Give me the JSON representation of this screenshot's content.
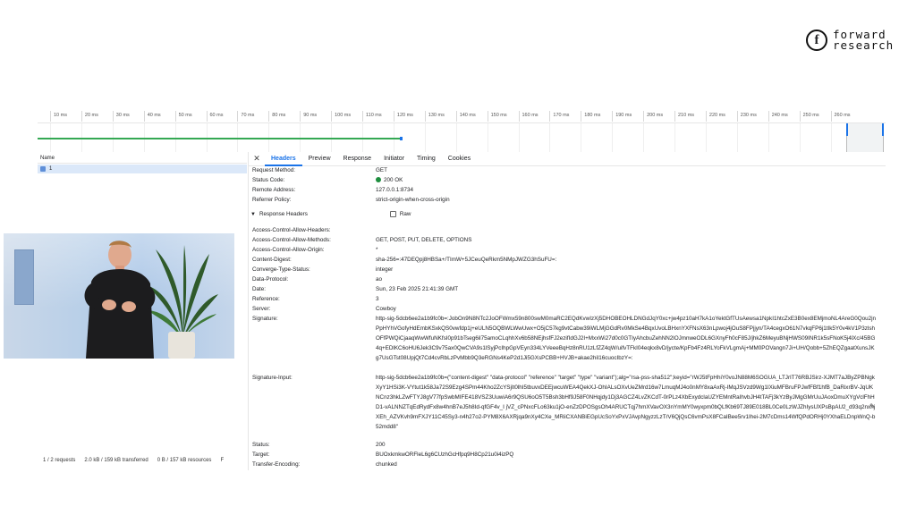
{
  "logo": {
    "mark": "f",
    "line1": "forward",
    "line2": "research"
  },
  "timeline": {
    "ticks": [
      "10 ms",
      "20 ms",
      "30 ms",
      "40 ms",
      "50 ms",
      "60 ms",
      "70 ms",
      "80 ms",
      "90 ms",
      "100 ms",
      "110 ms",
      "120 ms",
      "130 ms",
      "140 ms",
      "150 ms",
      "160 ms",
      "170 ms",
      "180 ms",
      "190 ms",
      "200 ms",
      "210 ms",
      "220 ms",
      "230 ms",
      "240 ms",
      "250 ms",
      "260 ms"
    ],
    "colors": {
      "waiting": "#34a853",
      "download": "#1a73e8"
    }
  },
  "requests": {
    "column_header": "Name",
    "rows": [
      {
        "name": "1"
      }
    ],
    "footer": {
      "count": "1 / 2 requests",
      "transferred": "2.0 kB / 159 kB transferred",
      "resources": "0 B / 157 kB resources",
      "extra": "F"
    }
  },
  "details": {
    "tabs": [
      "Headers",
      "Preview",
      "Response",
      "Initiator",
      "Timing",
      "Cookies"
    ],
    "active_tab": "Headers",
    "general": [
      {
        "k": "Request Method:",
        "v": "GET"
      },
      {
        "k": "Status Code:",
        "v": "200 OK"
      },
      {
        "k": "Remote Address:",
        "v": "127.0.0.1:8734"
      },
      {
        "k": "Referrer Policy:",
        "v": "strict-origin-when-cross-origin"
      }
    ],
    "response_headers_label": "Response Headers",
    "raw_label": "Raw",
    "headers": [
      {
        "k": "Access-Control-Allow-Headers:",
        "v": ""
      },
      {
        "k": "Access-Control-Allow-Methods:",
        "v": "GET, POST, PUT, DELETE, OPTIONS"
      },
      {
        "k": "Access-Control-Allow-Origin:",
        "v": "*"
      },
      {
        "k": "Content-Digest:",
        "v": "sha-256=:47DEQpj8HBSa+/TImW+5JCeuQeRkm5NMpJWZG3hSuFU=:"
      },
      {
        "k": "Converge-Type-Status:",
        "v": "integer"
      },
      {
        "k": "Data-Protocol:",
        "v": "ao"
      },
      {
        "k": "Date:",
        "v": "Sun, 23 Feb 2025 21:41:39 GMT"
      },
      {
        "k": "Reference:",
        "v": "3"
      },
      {
        "k": "Server:",
        "v": "Cowboy"
      }
    ],
    "signature_key": "Signature:",
    "signature_value": "http-sig-5dcb6ee2a1b9fc0b=:JobOn9N8NTc2JoOFWmx59n800swM0maRC2EQdKvwIzXj5DHOBEOHLDNGdJqY0xc+jw4pz10aH7kA1oYektGfTUsAewsa1NpkI1htcZxE3B0ex8EMjmoNL4AreG0Qou2jnPpHYhVGofyHdEmbKSxkQS0vwfdp1j+eULN5OQBWLWwUwx+O5jC57kg9vtCabw39iWLMjGGdRv0MkSe4BqxUvoLBHxnYXFNsX63nLpwoj4jOuS8FPjjyn/TA4cegxO61N7vkqFP6j1tIk5Y0v4kV1P3zlshOFfPWQiCjaaqWwWfuNKfsI0p91bTseg6il75amoCLqhhXv6b58NEjhsfFJ2ezifIdGJ2I+MxxWi27d0c0GTIyAhcbuZehNN2lOJmnweODL6GXnyFh0cF85J/jhkZ6MeyuBNjHWS09INR1k5sFNoK5j4lXc/45BG4q+EDlKC6oHU6Jek3C9v75ax0QwCVA9s1lSyjPcIhpGpVEyn334LYVeeeBqHz8nRU1zLfZZ4qW/uifvTFkI04eqkx8vD/jycte/KpFb4Fz4RLYoFkVLgmAj+MM0POVangn7Ji+UH/Qobb+5ZhEQZgaatXunsJKg7UsGTst08UpjQt7Cd4cvRbLzPvMbb9Q3eRGNs4KeP2d1Ji5GXsPCBB+HVJB+akae2hil16cuocIbzY=:",
    "signature_input_key": "Signature-Input:",
    "signature_input_value": "http-sig-5dcb6ee2a1b9fc0b=(\"content-digest\" \"data-protocol\" \"reference\" \"target\" \"type\" \"variant\");alg=\"rsa-pss-sha512\";keyid=\"rWJ5tFpHhiY0voJN88M6SOGUA_LTJrIT76RBJSirz-XJMT7aJByZPBNgkXyY1HSi3K-VYtut1k58Ja72S9Ezg4SPm44Kho2ZcYSjIt0lhI5tbuvxDEEjwcuWEA4QekXJ-OhIALsOXvUeZMrd16w7LmuqMJ4o0nMY8xaAxRj-IMqJSVzd9Wg1IXiuMFBruFPJwfFBf1hfB_DaRixrBV-JqUKNCnz3hkLZwFTYJ8gV77fpSwbMIFE418VSZ3UuwiA6r9QSU6oO5T5Bsh3bHf9J58F0NHqjdy1Dj3AGCZ4LvZKCdT-0rPLz4XbExydclaUZYEMntRaIhvbJH4tTAFj3kYzByJMgGMrUuJAoxDmuXYgVclFhHD1-vALNNZTqEdRydFx8w4hnB7eJ5h8Id-qfGF4v_I jVZ_cPNxcFLo63ku1jO-enZzDPOSgsOh4ARUCTqj7hmXVavOX3nYmMY0wyxpm0bQLfKb69TJ89E018BL0Ce0LzWJZhIysUXPsBpAU2_d93q2nxhjXEh_AZVKvh9mFXJY11C45Sy3-n4h27o2-PYM8X6AXRjqa9nXy4CXe_MRiiCXANBiEGpUcSoYxPxVJAvpNgyzzLzTrV6QjQsC6vmPsX8FCaIBee5rv1Ihei-2M7cDms14WfQPdORHj0YXhaELDnpWnQ-b52mdd8\"",
    "trailing": [
      {
        "k": "Status:",
        "v": "200"
      },
      {
        "k": "Target:",
        "v": "BUOxkmkwORFleL6g6CUzhGcHfpq9H8Cp21u0i4izPQ"
      },
      {
        "k": "Transfer-Encoding:",
        "v": "chunked"
      }
    ]
  }
}
